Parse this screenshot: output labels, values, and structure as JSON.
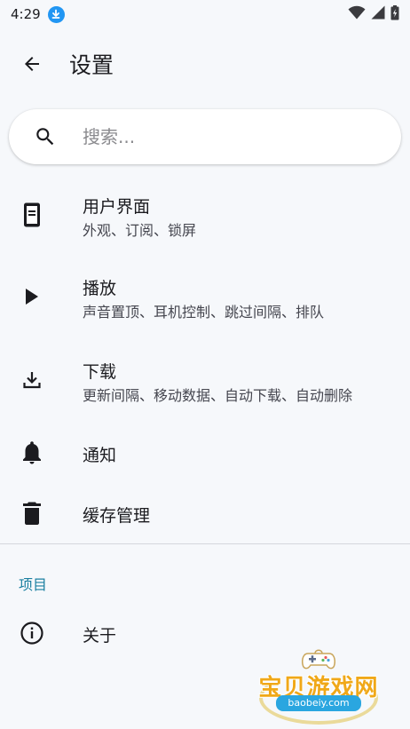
{
  "status_bar": {
    "time": "4:29",
    "icons": [
      "download-badge-icon",
      "wifi-icon",
      "signal-icon",
      "battery-charging-icon"
    ]
  },
  "app_bar": {
    "title": "设置",
    "back_icon": "arrow-back-icon"
  },
  "search": {
    "placeholder": "搜索...",
    "value": "",
    "icon": "search-icon"
  },
  "settings": [
    {
      "title": "用户界面",
      "subtitle": "外观、订阅、锁屏",
      "icon": "phone-screen-icon"
    },
    {
      "title": "播放",
      "subtitle": "声音置顶、耳机控制、跳过间隔、排队",
      "icon": "play-icon"
    },
    {
      "title": "下载",
      "subtitle": "更新间隔、移动数据、自动下载、自动删除",
      "icon": "download-icon"
    },
    {
      "title": "通知",
      "icon": "bell-icon"
    },
    {
      "title": "缓存管理",
      "icon": "trash-icon"
    }
  ],
  "section": {
    "header": "项目",
    "items": [
      {
        "title": "关于",
        "icon": "info-icon"
      }
    ]
  },
  "watermark": {
    "text": "宝贝游戏网",
    "url": "baobeiy.com"
  },
  "colors": {
    "background": "#f6f8fb",
    "accent": "#1a7fa0",
    "badge": "#2196f3",
    "watermark": "#f0a818"
  }
}
